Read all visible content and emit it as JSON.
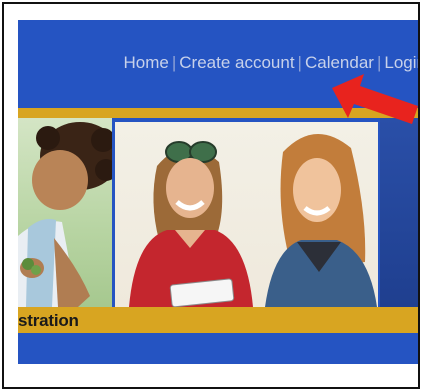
{
  "nav": {
    "items": [
      {
        "label": "Home"
      },
      {
        "label": "Create account"
      },
      {
        "label": "Calendar"
      },
      {
        "label": "Login"
      }
    ],
    "separator": "|"
  },
  "banner": {
    "label": "stration"
  },
  "colors": {
    "header_blue": "#2554c2",
    "accent_gold": "#d8a521",
    "nav_text": "#c7d1ea",
    "annotation_arrow": "#e8231e"
  },
  "annotation": {
    "icon": "red-arrow-icon",
    "points_to": "Login"
  }
}
